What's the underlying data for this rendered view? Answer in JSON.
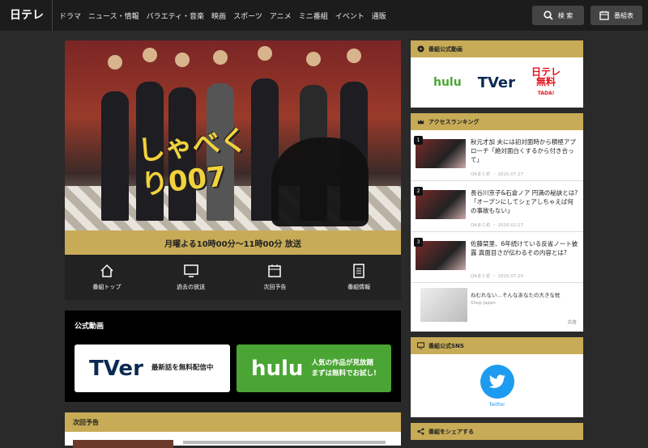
{
  "header": {
    "logo": "日テレ",
    "nav": [
      "ドラマ",
      "ニュース・情報",
      "バラエティ・音楽",
      "映画",
      "スポーツ",
      "アニメ",
      "ミニ番組",
      "イベント",
      "通販"
    ],
    "search_label": "検 索",
    "guide_label": "番組表"
  },
  "hero": {
    "logo_text": "しゃべくり007",
    "airtime": "月曜よる10時00分〜11時00分 放送"
  },
  "program_nav": [
    {
      "label": "番組トップ",
      "icon": "home-icon"
    },
    {
      "label": "過去の放送",
      "icon": "monitor-icon"
    },
    {
      "label": "次回予告",
      "icon": "calendar-icon"
    },
    {
      "label": "番組情報",
      "icon": "document-icon"
    }
  ],
  "official_video": {
    "heading": "公式動画",
    "tver_brand": "TVer",
    "tver_text": "最新話を無料配信中",
    "hulu_brand": "hulu",
    "hulu_text_1": "人気の作品が見放題",
    "hulu_text_2": "まずは無料でお試し!"
  },
  "next_preview": {
    "heading": "次回予告"
  },
  "sidebar": {
    "official_video_heading": "番組公式動画",
    "logos": {
      "hulu": "hulu",
      "tver": "TVer",
      "ntv_1": "日テレ",
      "ntv_2": "無料",
      "ntv_3": "TADA!"
    },
    "ranking_heading": "アクセスランキング",
    "ranking": [
      {
        "num": "1",
        "title": "秋元才加 夫には初対面時から積極アプローチ「絶対面白くするから付き合って」",
        "meta": "OAまとめ ・ 2020.07.27"
      },
      {
        "num": "2",
        "title": "長谷川京子&石倉ノア 円満の秘訣とは?「オープンにしてシェアしちゃえば何の事故もない」",
        "meta": "OAまとめ ・ 2020.02.17"
      },
      {
        "num": "3",
        "title": "佐藤栞里、6年続けている反省ノート披露 真面目さが伝わるその内容とは?",
        "meta": "OAまとめ ・ 2020.07.20"
      }
    ],
    "ad": {
      "title": "ねむれない…そんなあなたの大きな枕",
      "source": "Shop Japan",
      "pr": "広告"
    },
    "sns_heading": "番組公式SNS",
    "sns_label": "Twitter",
    "share_heading": "番組をシェアする"
  },
  "colors": {
    "accent_gold": "#c7ab57",
    "header_bg": "#1c1c1c",
    "hulu_green": "#4aa534",
    "twitter_blue": "#1d9bf0"
  }
}
